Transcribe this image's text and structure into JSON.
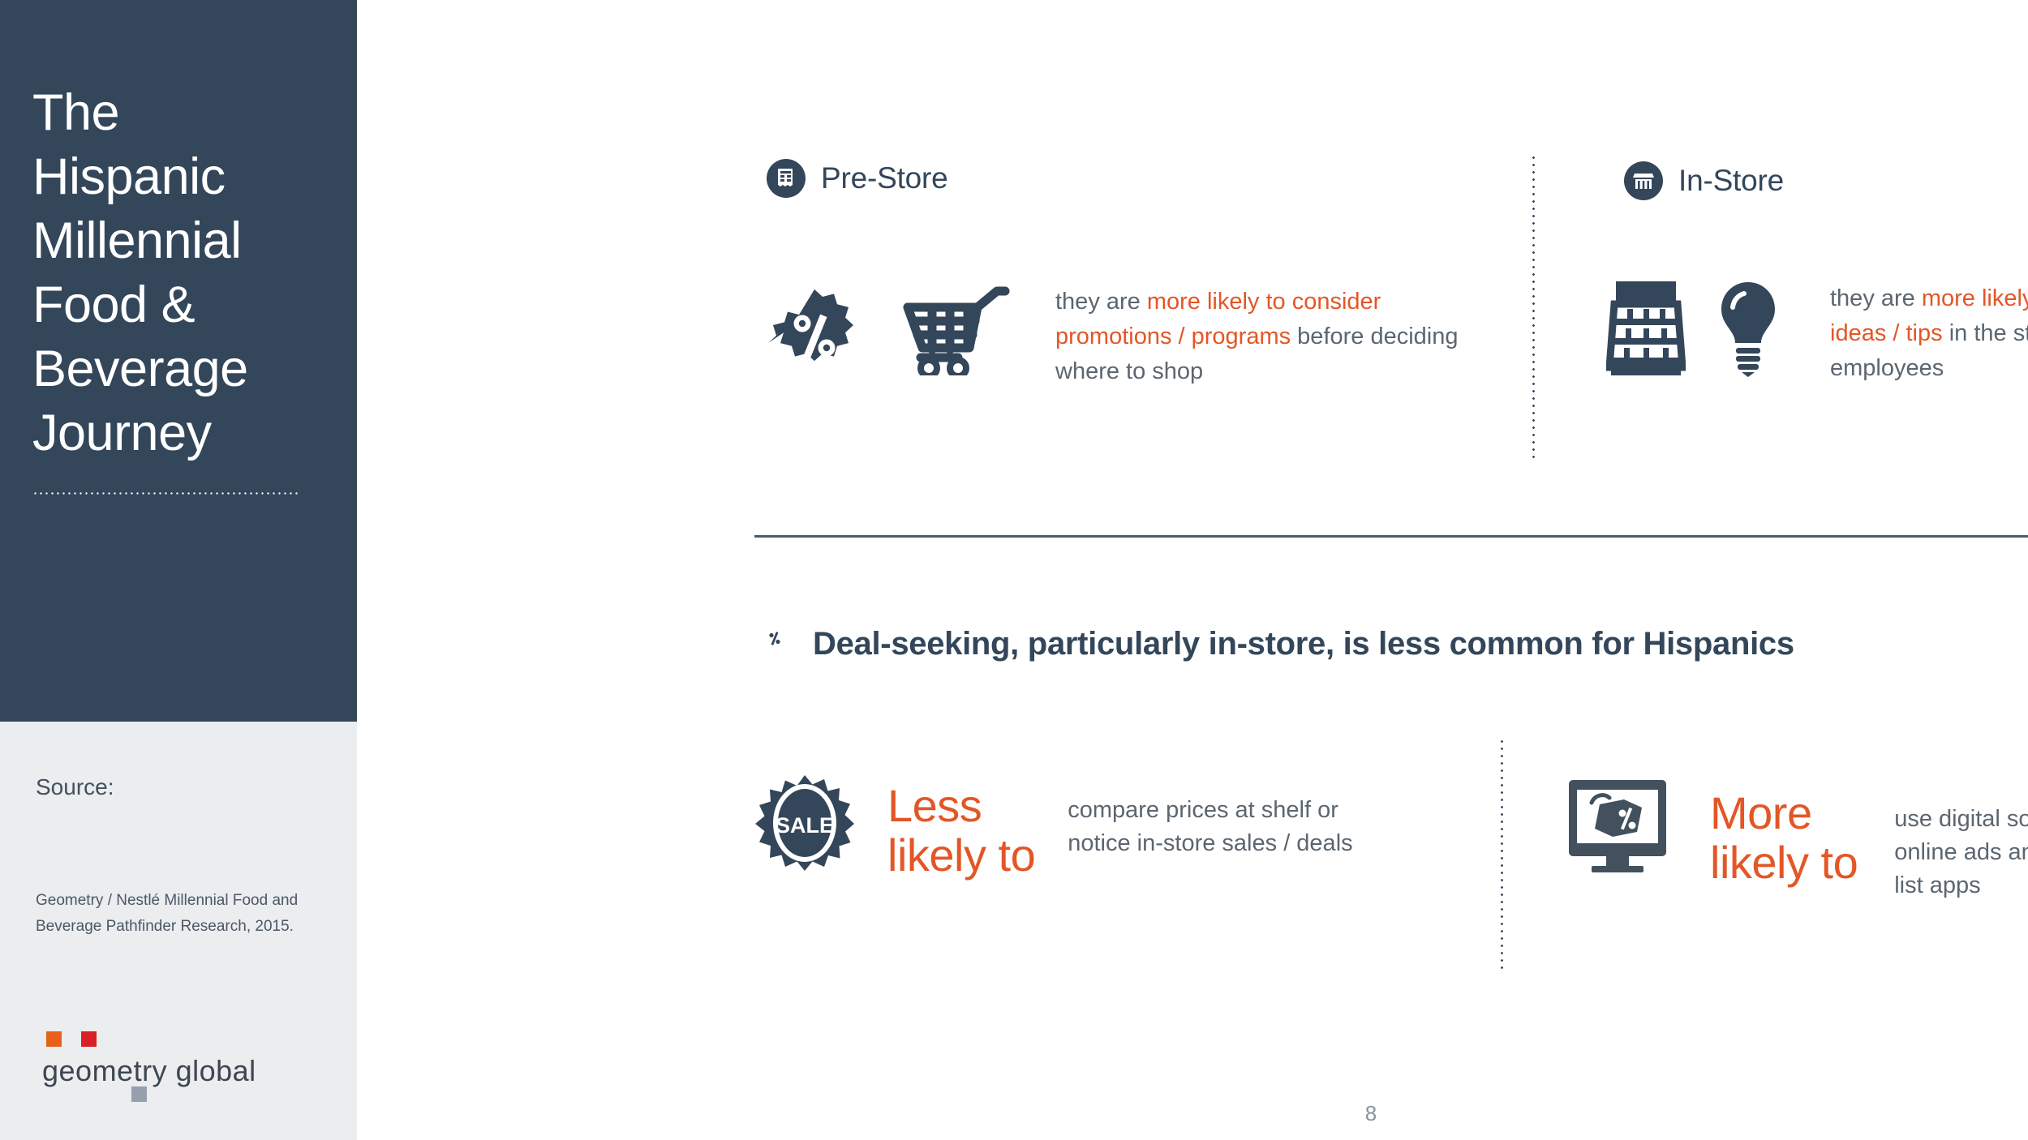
{
  "sidebar": {
    "deck_title": "The Hispanic Millennial Food & Beverage Journey",
    "source_label": "Source:",
    "source_text": "Geometry / Nestlé Millennial Food and Beverage Pathfinder Research, 2015.",
    "logo_word": "geometry global"
  },
  "colors": {
    "navy": "#33465a",
    "orange_accent": "#e35626",
    "body_text": "#5b6670",
    "panel_gray": "#ebedef",
    "logo_orange": "#e8601c",
    "logo_red": "#d92026",
    "logo_gray": "#95a0ac"
  },
  "stages": {
    "pre_store": {
      "icon": "receipt-icon",
      "title": "Pre-Store",
      "icons": [
        "percent-badge-icon",
        "shopping-cart-icon"
      ],
      "copy_pre": "they are ",
      "copy_highlight": "more likely to consider promotions / programs",
      "copy_post": " before deciding where to shop"
    },
    "in_store": {
      "icon": "storefront-icon",
      "title": "In-Store",
      "icons": [
        "store-shelf-icon",
        "lightbulb-icon"
      ],
      "copy_pre": "they are ",
      "copy_highlight": "more likely to try samples, notice ideas / tips",
      "copy_post": " in the store and talk with store employees"
    }
  },
  "deal_section": {
    "icon": "percent-circle-icon",
    "title": "Deal-seeking, particularly in-store, is less common for Hispanics",
    "stats": [
      {
        "icon": "sale-badge-icon",
        "icon_label": "SALE",
        "headline_line1": "Less",
        "headline_line2": "likely to",
        "detail": "compare prices at shelf or notice in-store sales / deals"
      },
      {
        "icon": "monitor-price-tag-icon",
        "headline_line1": "More",
        "headline_line2": "likely to",
        "detail": "use digital sources like online ads and shopping list apps"
      }
    ]
  },
  "footer": {
    "page_number": "8"
  }
}
